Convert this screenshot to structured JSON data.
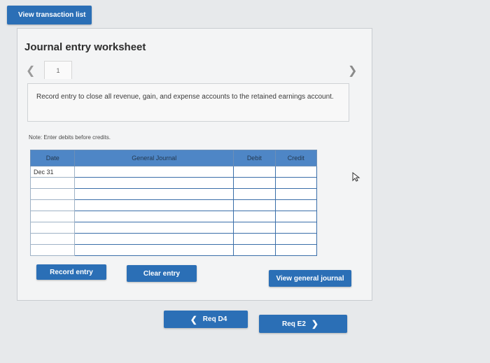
{
  "topbar": {
    "view_transaction_label": "View transaction list"
  },
  "worksheet": {
    "title": "Journal entry worksheet",
    "current_page": "1",
    "instruction": "Record entry to close all revenue, gain, and expense accounts to the retained earnings account.",
    "note": "Note: Enter debits before credits."
  },
  "table": {
    "headers": {
      "date": "Date",
      "journal": "General Journal",
      "debit": "Debit",
      "credit": "Credit"
    },
    "first_date": "Dec 31"
  },
  "actions": {
    "record_entry": "Record entry",
    "clear_entry": "Clear entry",
    "view_general_journal": "View general journal"
  },
  "nav": {
    "prev_req": "Req D4",
    "next_req": "Req E2"
  },
  "colors": {
    "button_blue": "#2b6fb6",
    "header_blue": "#4e86c6"
  }
}
